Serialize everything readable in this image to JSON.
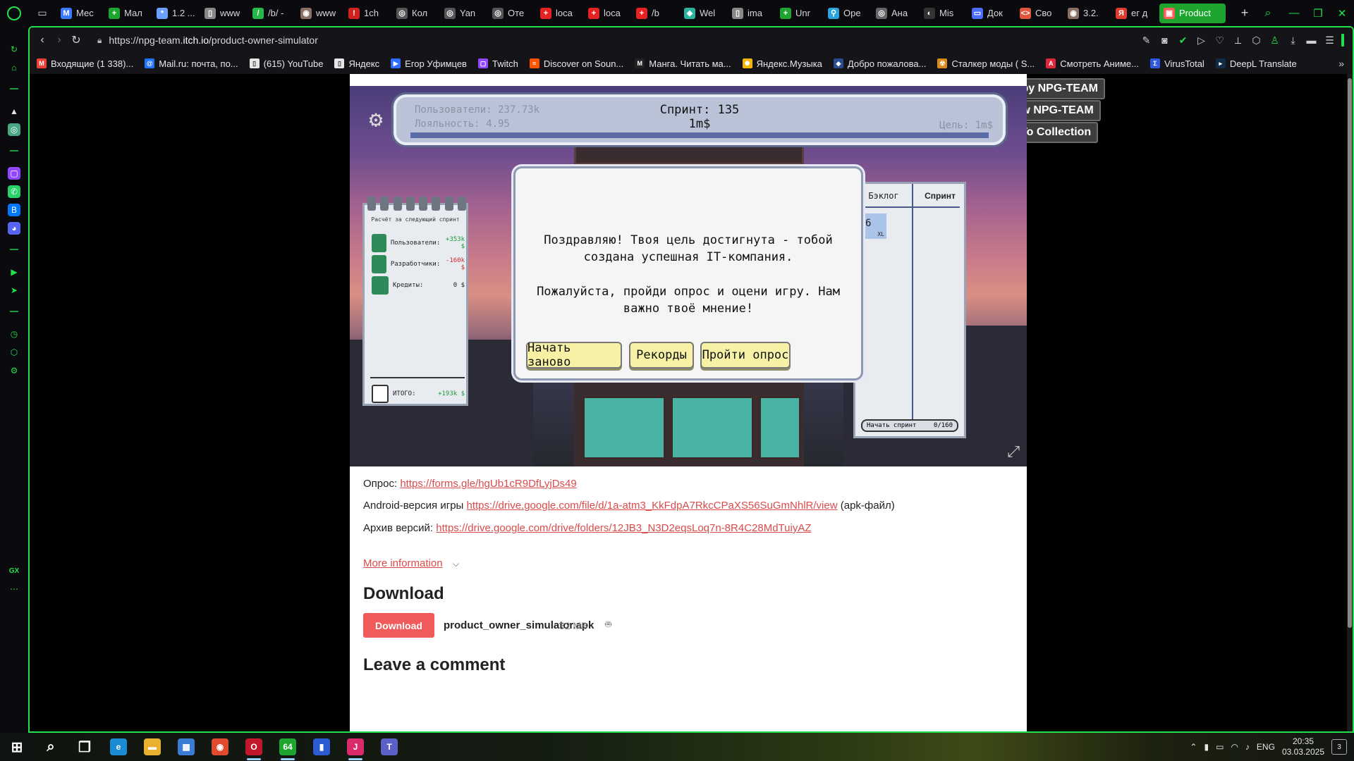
{
  "browser": {
    "tabs": [
      {
        "label": "Мес",
        "color": "#3b7bff",
        "glyph": "M"
      },
      {
        "label": "Мал",
        "color": "#1ea52f",
        "glyph": "+"
      },
      {
        "label": "1.2 ...",
        "color": "#6aa0ff",
        "glyph": "*"
      },
      {
        "label": "www",
        "color": "#888",
        "glyph": "▯"
      },
      {
        "label": "/b/ -",
        "color": "#27b84a",
        "glyph": "/"
      },
      {
        "label": "www",
        "color": "#8a6f63",
        "glyph": "◉"
      },
      {
        "label": "1ch",
        "color": "#d0211c",
        "glyph": "!"
      },
      {
        "label": "Кол",
        "color": "#555",
        "glyph": "◎"
      },
      {
        "label": "Yan",
        "color": "#555",
        "glyph": "◎"
      },
      {
        "label": "Оте",
        "color": "#555",
        "glyph": "◎"
      },
      {
        "label": "loca",
        "color": "#e52222",
        "glyph": "+"
      },
      {
        "label": "loca",
        "color": "#e52222",
        "glyph": "+"
      },
      {
        "label": "/b",
        "color": "#e52222",
        "glyph": "+"
      },
      {
        "label": "Wel",
        "color": "#2ab3a0",
        "glyph": "◆"
      },
      {
        "label": "ima",
        "color": "#888",
        "glyph": "▯"
      },
      {
        "label": "Unr",
        "color": "#1ea52f",
        "glyph": "+"
      },
      {
        "label": "Ope",
        "color": "#29a3d9",
        "glyph": "⚲"
      },
      {
        "label": "Ана",
        "color": "#666",
        "glyph": "◎"
      },
      {
        "label": "Mis",
        "color": "#333",
        "glyph": "◐"
      },
      {
        "label": "Док",
        "color": "#4a6cff",
        "glyph": "▭"
      },
      {
        "label": "Сво",
        "color": "#e0563a",
        "glyph": "<>"
      },
      {
        "label": "3.2.",
        "color": "#8a6f63",
        "glyph": "◉"
      },
      {
        "label": "ег д",
        "color": "#e03b2e",
        "glyph": "Я"
      },
      {
        "label": "Product",
        "color": "#fa5c5c",
        "glyph": "▣",
        "active": true
      }
    ],
    "new_tab": "+",
    "url_prefix": "https://npg-team.",
    "url_host": "itch.io",
    "url_path": "/product-owner-simulator",
    "bookmarks": [
      {
        "label": "Входящие (1 338)...",
        "color": "#ea4335",
        "glyph": "M"
      },
      {
        "label": "Mail.ru: почта, по...",
        "color": "#1e73ff",
        "glyph": "@"
      },
      {
        "label": "(615) YouTube",
        "color": "#e6e6e6",
        "glyph": "▯"
      },
      {
        "label": "Яндекс",
        "color": "#e6e6e6",
        "glyph": "▯"
      },
      {
        "label": "Егор Уфимцев",
        "color": "#2d6dff",
        "glyph": "▶"
      },
      {
        "label": "Twitch",
        "color": "#9146ff",
        "glyph": "▢"
      },
      {
        "label": "Discover on Soun...",
        "color": "#ff5500",
        "glyph": "≈"
      },
      {
        "label": "Манга. Читать ма...",
        "color": "#222",
        "glyph": "M"
      },
      {
        "label": "Яндекс.Музыка",
        "color": "#f5b400",
        "glyph": "✺"
      },
      {
        "label": "Добро пожалова...",
        "color": "#2a4b8d",
        "glyph": "◆"
      },
      {
        "label": "Сталкер моды ( S...",
        "color": "#d88a1a",
        "glyph": "☢"
      },
      {
        "label": "Смотреть Аниме...",
        "color": "#e0263a",
        "glyph": "A"
      },
      {
        "label": "VirusTotal",
        "color": "#2f5ae0",
        "glyph": "Σ"
      },
      {
        "label": "DeepL Translate",
        "color": "#0f2b46",
        "glyph": "▸"
      }
    ],
    "bookmarks_more": "»"
  },
  "itch": {
    "view_all": "View all by NPG-TEAM",
    "follow": "Follow NPG-TEAM",
    "add_collection": "Add To Collection"
  },
  "game": {
    "hud_users": "Пользователи: 237.73k",
    "hud_loyalty": "Лояльность: 4.95",
    "hud_sprint": "Спринт: 135",
    "hud_money": "1m$",
    "hud_goal": "Цель: 1m$",
    "notepad_title": "Расчёт за следующий спринт",
    "notepad_rows": [
      {
        "label": "Пользователи:",
        "value": "+353k $",
        "tone": "pos"
      },
      {
        "label": "Разработчики:",
        "value": "-160k $",
        "tone": "neg"
      },
      {
        "label": "Кредиты:",
        "value": "0 $",
        "tone": "zero"
      }
    ],
    "notepad_total_label": "ИТОГО:",
    "notepad_total_value": "+193k $",
    "board_backlog": "Бэклог",
    "board_sprint": "Спринт",
    "board_card_value": "6",
    "board_card_size": "XL",
    "board_start": "Начать спринт",
    "board_capacity": "0/160",
    "modal_line1": "Поздравляю! Твоя цель достигнута - тобой создана успешная IT-компания.",
    "modal_line2": "Пожалуйста, пройди опрос и оцени игру. Нам важно твоё мнение!",
    "btn_restart": "Начать заново",
    "btn_records": "Рекорды",
    "btn_survey": "Пройти опрос"
  },
  "page": {
    "survey_label": "Опрос:",
    "survey_link": "https://forms.gle/hgUb1cR9DfLyjDs49",
    "android_label": "Android-версия игры",
    "android_link": "https://drive.google.com/file/d/1a-atm3_KkFdpA7RkcCPaXS56SuGmNhlR/view",
    "android_suffix": "(apk-файл)",
    "archive_label": "Архив версий:",
    "archive_link": "https://drive.google.com/drive/folders/12JB3_N3D2eqsLoq7n-8R4C28MdTuiyAZ",
    "more_info": "More information",
    "download_heading": "Download",
    "download_button": "Download",
    "file_name": "product_owner_simulator.apk",
    "file_size": "32 MB",
    "comment_heading": "Leave a comment"
  },
  "taskbar": {
    "apps": [
      {
        "name": "start-button",
        "glyph": "⊞",
        "color": "transparent"
      },
      {
        "name": "search-app",
        "glyph": "⌕",
        "color": "transparent"
      },
      {
        "name": "task-view",
        "glyph": "❐",
        "color": "transparent"
      },
      {
        "name": "edge-app",
        "glyph": "e",
        "color": "#1c8bd6",
        "run": false
      },
      {
        "name": "explorer-app",
        "glyph": "▬",
        "color": "#e8b22e",
        "run": false
      },
      {
        "name": "store-app",
        "glyph": "▦",
        "color": "#3a7bd5",
        "run": false
      },
      {
        "name": "chrome-app",
        "glyph": "◉",
        "color": "#e04a2e",
        "run": false
      },
      {
        "name": "opera-gx-app",
        "glyph": "O",
        "color": "#c2182b",
        "run": true
      },
      {
        "name": "aida64-app",
        "glyph": "64",
        "color": "#1ea52f",
        "run": true
      },
      {
        "name": "stats-app",
        "glyph": "▮",
        "color": "#2d5bd1",
        "run": false
      },
      {
        "name": "jetbrains-app",
        "glyph": "J",
        "color": "#d92b6b",
        "run": true
      },
      {
        "name": "teams-app",
        "glyph": "T",
        "color": "#5b5fc7",
        "run": false
      }
    ],
    "lang": "ENG",
    "time": "20:35",
    "date": "03.03.2025",
    "notifications": "3"
  }
}
